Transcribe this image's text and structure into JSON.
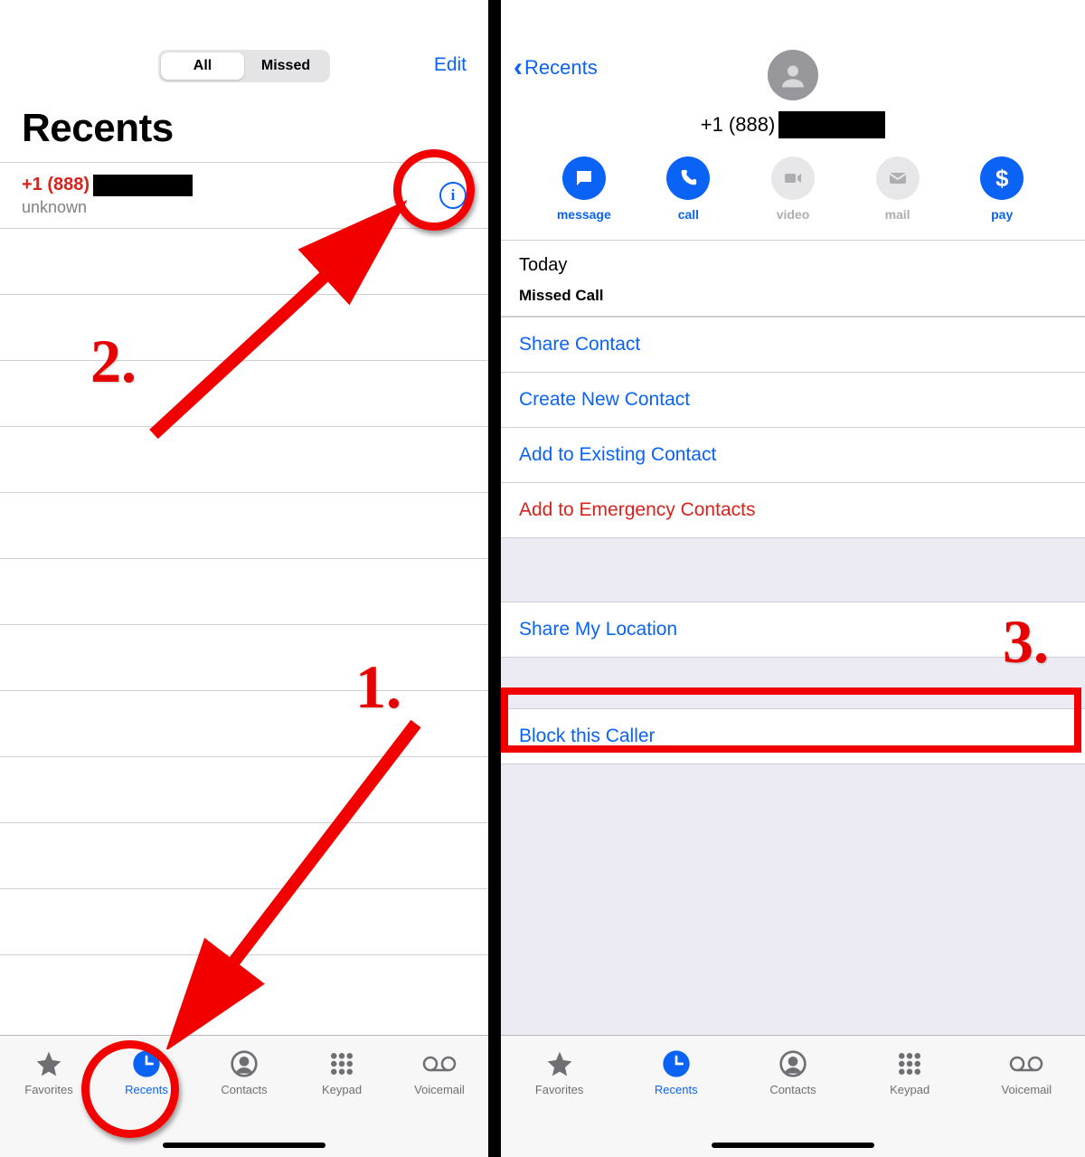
{
  "colors": {
    "accent": "#0b63f6",
    "danger": "#d9221c",
    "annotation": "#f20000"
  },
  "left": {
    "segmented": {
      "all": "All",
      "missed": "Missed"
    },
    "edit": "Edit",
    "title": "Recents",
    "recent": {
      "number_visible": "+1 (888)",
      "sublabel": "unknown"
    }
  },
  "right": {
    "back_label": "Recents",
    "phone_visible": "+1 (888)",
    "actions": [
      {
        "label": "message",
        "enabled": true
      },
      {
        "label": "call",
        "enabled": true
      },
      {
        "label": "video",
        "enabled": false
      },
      {
        "label": "mail",
        "enabled": false
      },
      {
        "label": "pay",
        "enabled": true
      }
    ],
    "today_label": "Today",
    "missed_call_label": "Missed Call",
    "options": {
      "share_contact": "Share Contact",
      "create_contact": "Create New Contact",
      "add_existing": "Add to Existing Contact",
      "add_emergency": "Add to Emergency Contacts",
      "share_location": "Share My Location",
      "block_caller": "Block this Caller"
    }
  },
  "tabs": [
    {
      "label": "Favorites"
    },
    {
      "label": "Recents"
    },
    {
      "label": "Contacts"
    },
    {
      "label": "Keypad"
    },
    {
      "label": "Voicemail"
    }
  ],
  "annotations": {
    "step1": "1.",
    "step2": "2.",
    "step3": "3."
  }
}
